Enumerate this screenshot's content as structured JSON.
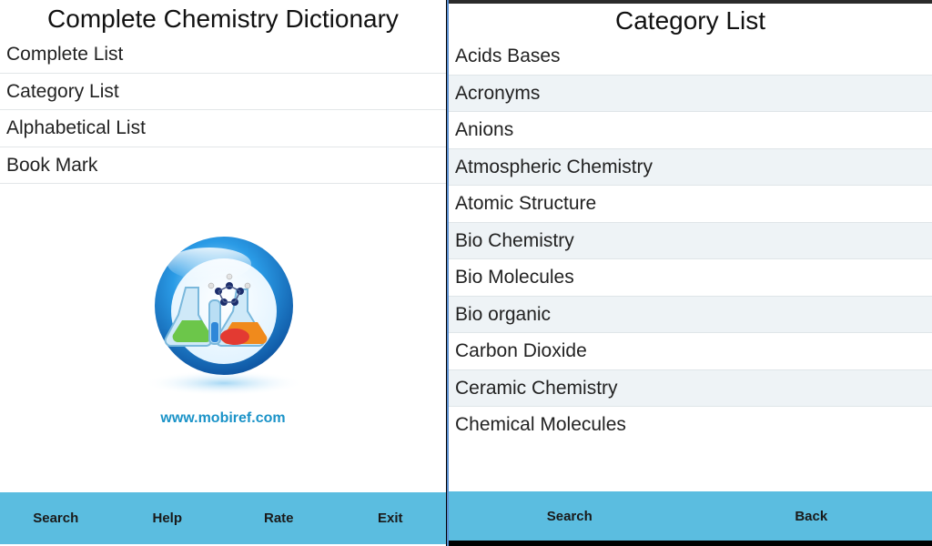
{
  "left_screen": {
    "title": "Complete Chemistry Dictionary",
    "menu": [
      {
        "label": "Complete List"
      },
      {
        "label": "Category List"
      },
      {
        "label": "Alphabetical List"
      },
      {
        "label": "Book Mark"
      }
    ],
    "logo_icon": "chemistry-flasks-globe-icon",
    "website": "www.mobiref.com",
    "toolbar": [
      "Search",
      "Help",
      "Rate",
      "Exit"
    ]
  },
  "right_screen": {
    "title": "Category List",
    "categories": [
      {
        "label": "Acids Bases"
      },
      {
        "label": "Acronyms"
      },
      {
        "label": "Anions"
      },
      {
        "label": "Atmospheric Chemistry"
      },
      {
        "label": "Atomic Structure"
      },
      {
        "label": "Bio Chemistry"
      },
      {
        "label": "Bio Molecules"
      },
      {
        "label": "Bio organic"
      },
      {
        "label": "Carbon Dioxide"
      },
      {
        "label": "Ceramic Chemistry"
      },
      {
        "label": "Chemical Molecules"
      }
    ],
    "toolbar": [
      "Search",
      "Back"
    ]
  },
  "colors": {
    "toolbar_bg": "#5bbde0",
    "link": "#1b93c8",
    "row_alt": "#eef3f6",
    "divider": "#5b8fd0"
  }
}
